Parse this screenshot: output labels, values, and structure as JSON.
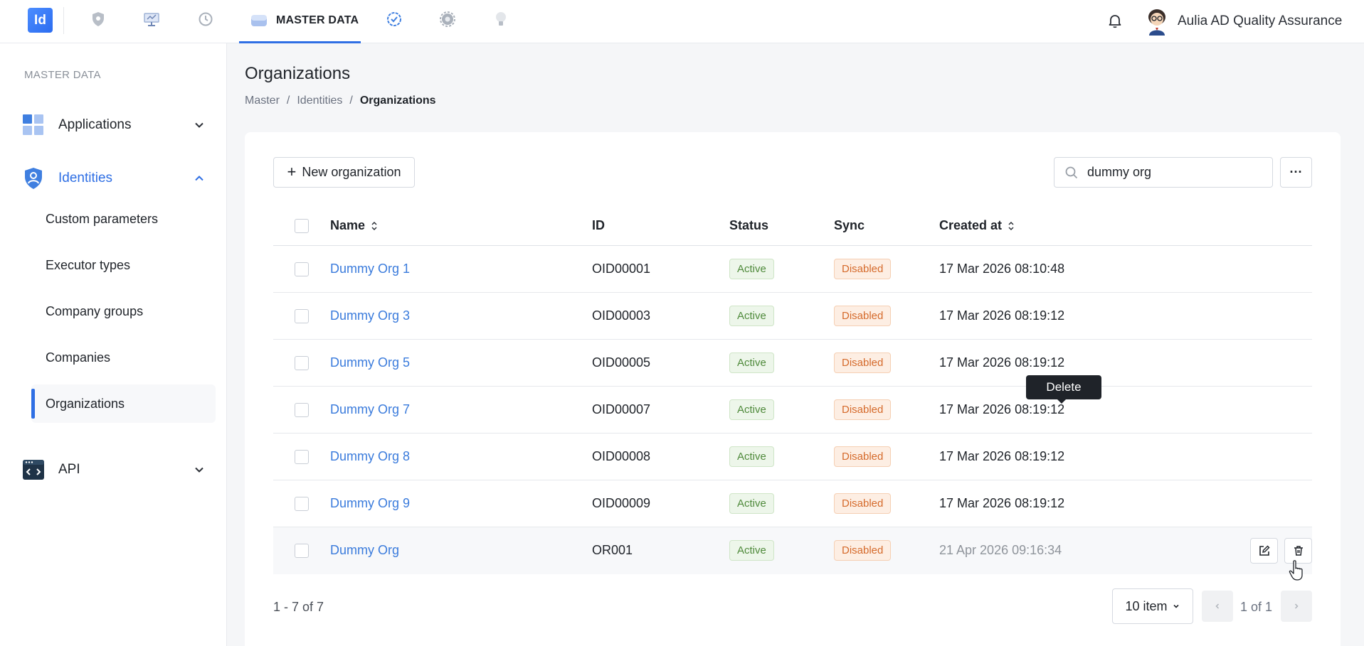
{
  "topbar": {
    "logo_text": "Id",
    "active_tab_label": "MASTER DATA",
    "user_name": "Aulia AD Quality Assurance",
    "accent": "#2f6fe4"
  },
  "sidebar": {
    "heading": "MASTER DATA",
    "groups": [
      {
        "label": "Applications",
        "icon": "applications-grid-icon",
        "expanded": false
      },
      {
        "label": "Identities",
        "icon": "identity-shield-icon",
        "expanded": true
      },
      {
        "label": "API",
        "icon": "api-code-icon",
        "expanded": false
      }
    ],
    "identities_children": [
      {
        "label": "Custom parameters"
      },
      {
        "label": "Executor types"
      },
      {
        "label": "Company groups"
      },
      {
        "label": "Companies"
      },
      {
        "label": "Organizations",
        "selected": true
      }
    ]
  },
  "page": {
    "title": "Organizations",
    "breadcrumb": [
      "Master",
      "Identities",
      "Organizations"
    ],
    "breadcrumb_sep": "/"
  },
  "toolbar": {
    "new_label": "New organization",
    "search_value": "dummy org",
    "more_label": "···"
  },
  "table": {
    "columns": {
      "name": "Name",
      "id": "ID",
      "status": "Status",
      "sync": "Sync",
      "created": "Created at"
    },
    "rows": [
      {
        "name": "Dummy Org 1",
        "id": "OID00001",
        "status": "Active",
        "sync": "Disabled",
        "created": "17 Mar 2026 08:10:48"
      },
      {
        "name": "Dummy Org 3",
        "id": "OID00003",
        "status": "Active",
        "sync": "Disabled",
        "created": "17 Mar 2026 08:19:12"
      },
      {
        "name": "Dummy Org 5",
        "id": "OID00005",
        "status": "Active",
        "sync": "Disabled",
        "created": "17 Mar 2026 08:19:12"
      },
      {
        "name": "Dummy Org 7",
        "id": "OID00007",
        "status": "Active",
        "sync": "Disabled",
        "created": "17 Mar 2026 08:19:12"
      },
      {
        "name": "Dummy Org 8",
        "id": "OID00008",
        "status": "Active",
        "sync": "Disabled",
        "created": "17 Mar 2026 08:19:12"
      },
      {
        "name": "Dummy Org 9",
        "id": "OID00009",
        "status": "Active",
        "sync": "Disabled",
        "created": "17 Mar 2026 08:19:12"
      },
      {
        "name": "Dummy Org",
        "id": "OR001",
        "status": "Active",
        "sync": "Disabled",
        "created": "21 Apr 2026 09:16:34"
      }
    ],
    "tooltip": "Delete"
  },
  "pagination": {
    "count_text": "1 - 7 of 7",
    "page_size": "10 item",
    "page_info": "1 of 1"
  }
}
